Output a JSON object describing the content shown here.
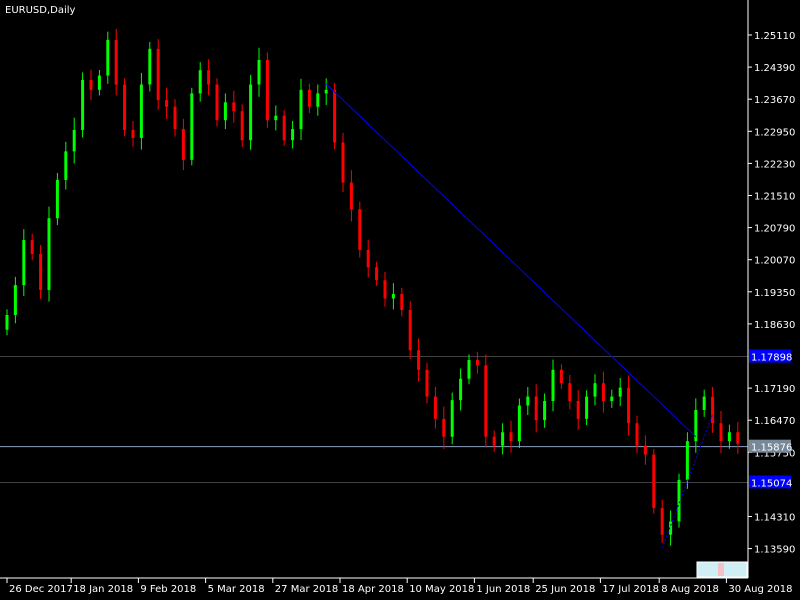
{
  "chart_data": {
    "type": "candlestick",
    "title": "EURUSD,Daily",
    "ylim": [
      1.1325,
      1.2555
    ],
    "y_ticks": [
      1.2511,
      1.2439,
      1.2367,
      1.2295,
      1.2223,
      1.2151,
      1.2079,
      1.2007,
      1.1935,
      1.1863,
      1.1719,
      1.1647,
      1.1575,
      1.1431,
      1.1359
    ],
    "x_tick_labels": [
      {
        "label": "26 Dec 2017",
        "bar": 0
      },
      {
        "label": "18 Jan 2018",
        "bar": 8
      },
      {
        "label": "9 Feb 2018",
        "bar": 16
      },
      {
        "label": "5 Mar 2018",
        "bar": 24
      },
      {
        "label": "27 Mar 2018",
        "bar": 32
      },
      {
        "label": "18 Apr 2018",
        "bar": 40
      },
      {
        "label": "10 May 2018",
        "bar": 48
      },
      {
        "label": "1 Jun 2018",
        "bar": 56
      },
      {
        "label": "25 Jun 2018",
        "bar": 63
      },
      {
        "label": "17 Jul 2018",
        "bar": 71
      },
      {
        "label": "8 Aug 2018",
        "bar": 78
      },
      {
        "label": "30 Aug 2018",
        "bar": 86
      }
    ],
    "open_start": 1.185,
    "closes": [
      1.1883,
      1.195,
      1.2051,
      1.202,
      1.1939,
      1.21,
      1.2186,
      1.225,
      1.2298,
      1.241,
      1.2388,
      1.242,
      1.25,
      1.24,
      1.2298,
      1.228,
      1.24,
      1.248,
      1.2365,
      1.235,
      1.23,
      1.2231,
      1.238,
      1.2432,
      1.24,
      1.232,
      1.236,
      1.234,
      1.2275,
      1.24,
      1.2455,
      1.232,
      1.233,
      1.2275,
      1.23,
      1.2388,
      1.235,
      1.238,
      1.2388,
      1.227,
      1.218,
      1.212,
      1.2029,
      1.199,
      1.1961,
      1.192,
      1.193,
      1.1894,
      1.1804,
      1.176,
      1.17,
      1.165,
      1.161,
      1.1692,
      1.174,
      1.1782,
      1.177,
      1.161,
      1.159,
      1.162,
      1.16,
      1.168,
      1.17,
      1.1647,
      1.169,
      1.176,
      1.173,
      1.169,
      1.165,
      1.17,
      1.173,
      1.169,
      1.17,
      1.172,
      1.164,
      1.159,
      1.157,
      1.145,
      1.139,
      1.142,
      1.1513,
      1.16,
      1.167,
      1.17,
      1.164,
      1.16,
      1.162,
      1.1594
    ],
    "horizontal_lines": [
      {
        "price": 1.17898,
        "label": "1.17898",
        "color": "#404040",
        "label_bg": "#0000ff"
      },
      {
        "price": 1.15876,
        "label": "1.15876",
        "color": "#8aa0c0",
        "label_bg": "#778899"
      },
      {
        "price": 1.15074,
        "label": "1.15074",
        "color": "#404040",
        "label_bg": "#0000ff"
      }
    ],
    "trendline": {
      "from": {
        "bar": 38,
        "price": 1.2401
      },
      "to": {
        "bar": 82,
        "price": 1.161
      },
      "color": "#0000ff"
    },
    "dotted_line": {
      "from": {
        "bar": 78,
        "price": 1.136
      },
      "to": {
        "bar": 84,
        "price": 1.166
      },
      "color": "#0000ff"
    },
    "colors": {
      "bull": "#00ff00",
      "bear": "#ff0000",
      "axis": "#ffffff",
      "background": "#000000"
    }
  }
}
